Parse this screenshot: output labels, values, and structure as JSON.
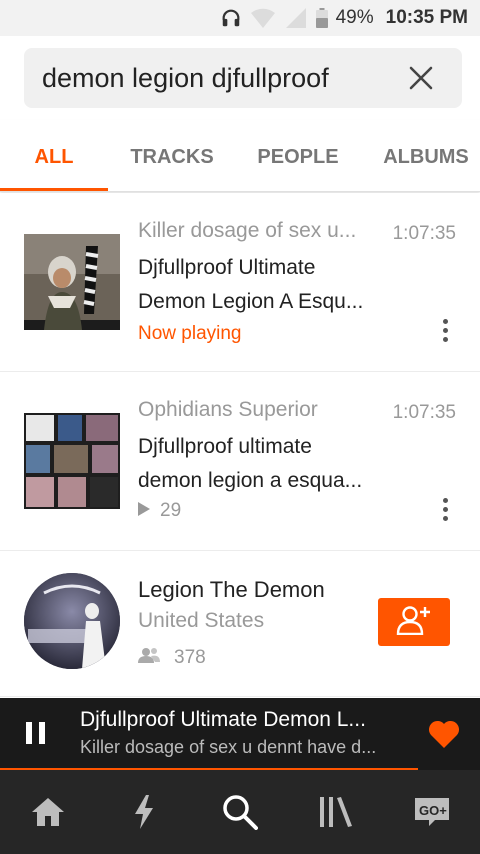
{
  "status_bar": {
    "battery": "49%",
    "time": "10:35 PM",
    "icons": [
      "headphones-icon",
      "wifi-icon",
      "signal-icon",
      "battery-icon"
    ]
  },
  "search": {
    "query": "demon legion djfullproof",
    "clear_icon": "close-icon"
  },
  "tabs": [
    {
      "label": "ALL",
      "active": true
    },
    {
      "label": "TRACKS",
      "active": false
    },
    {
      "label": "PEOPLE",
      "active": false
    },
    {
      "label": "ALBUMS",
      "active": false
    }
  ],
  "results": [
    {
      "kind": "track",
      "user": "Killer dosage of sex u...",
      "duration": "1:07:35",
      "title_line1": "Djfullproof Ultimate",
      "title_line2": "Demon Legion A Esqu...",
      "status": "Now playing"
    },
    {
      "kind": "track",
      "user": "Ophidians Superior",
      "duration": "1:07:35",
      "title_line1": "Djfullproof ultimate",
      "title_line2": "demon legion a esqua...",
      "plays": "29"
    },
    {
      "kind": "user",
      "name": "Legion The Demon",
      "location": "United States",
      "followers": "378"
    }
  ],
  "player": {
    "title": "Djfullproof Ultimate Demon L...",
    "subtitle": "Killer dosage of sex u dennt have d...",
    "progress": 0.87
  },
  "bottom_nav": [
    "home-icon",
    "stream-icon",
    "search-icon",
    "library-icon",
    "go-plus-icon"
  ],
  "colors": {
    "accent": "#ff5500",
    "player_bg": "#1a1a1a",
    "nav_bg": "#262626"
  }
}
